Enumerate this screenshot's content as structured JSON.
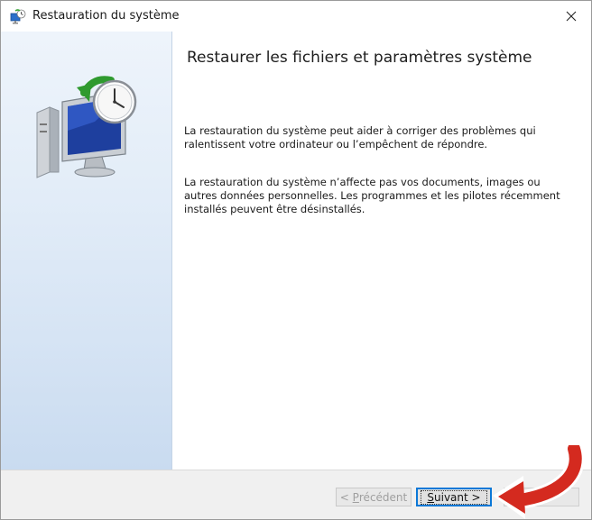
{
  "window": {
    "title": "Restauration du système",
    "icon": "system-restore-icon",
    "close_icon": "close-icon"
  },
  "sidebar": {
    "illustration": "monitor-restore-clock-icon"
  },
  "content": {
    "heading": "Restaurer les fichiers et paramètres système",
    "paragraph1": "La restauration du système peut aider à corriger des problèmes qui ralentissent votre ordinateur ou l’empêchent de répondre.",
    "paragraph2": "La restauration du système n’affecte pas vos documents, images ou autres données personnelles. Les programmes et les pilotes récemment installés peuvent être désinstallés."
  },
  "footer": {
    "prev_button": {
      "prefix": "< ",
      "mnemonic": "P",
      "rest": "récédent",
      "enabled": false
    },
    "next_button": {
      "mnemonic": "S",
      "rest": "uivant >",
      "enabled": true
    }
  },
  "overlay": {
    "arrow_color": "#d42a1f",
    "icon": "red-arrow-icon"
  },
  "colors": {
    "accent": "#0b78d7",
    "sidebar_top": "#eef4fb",
    "sidebar_bottom": "#c9dbf0"
  }
}
